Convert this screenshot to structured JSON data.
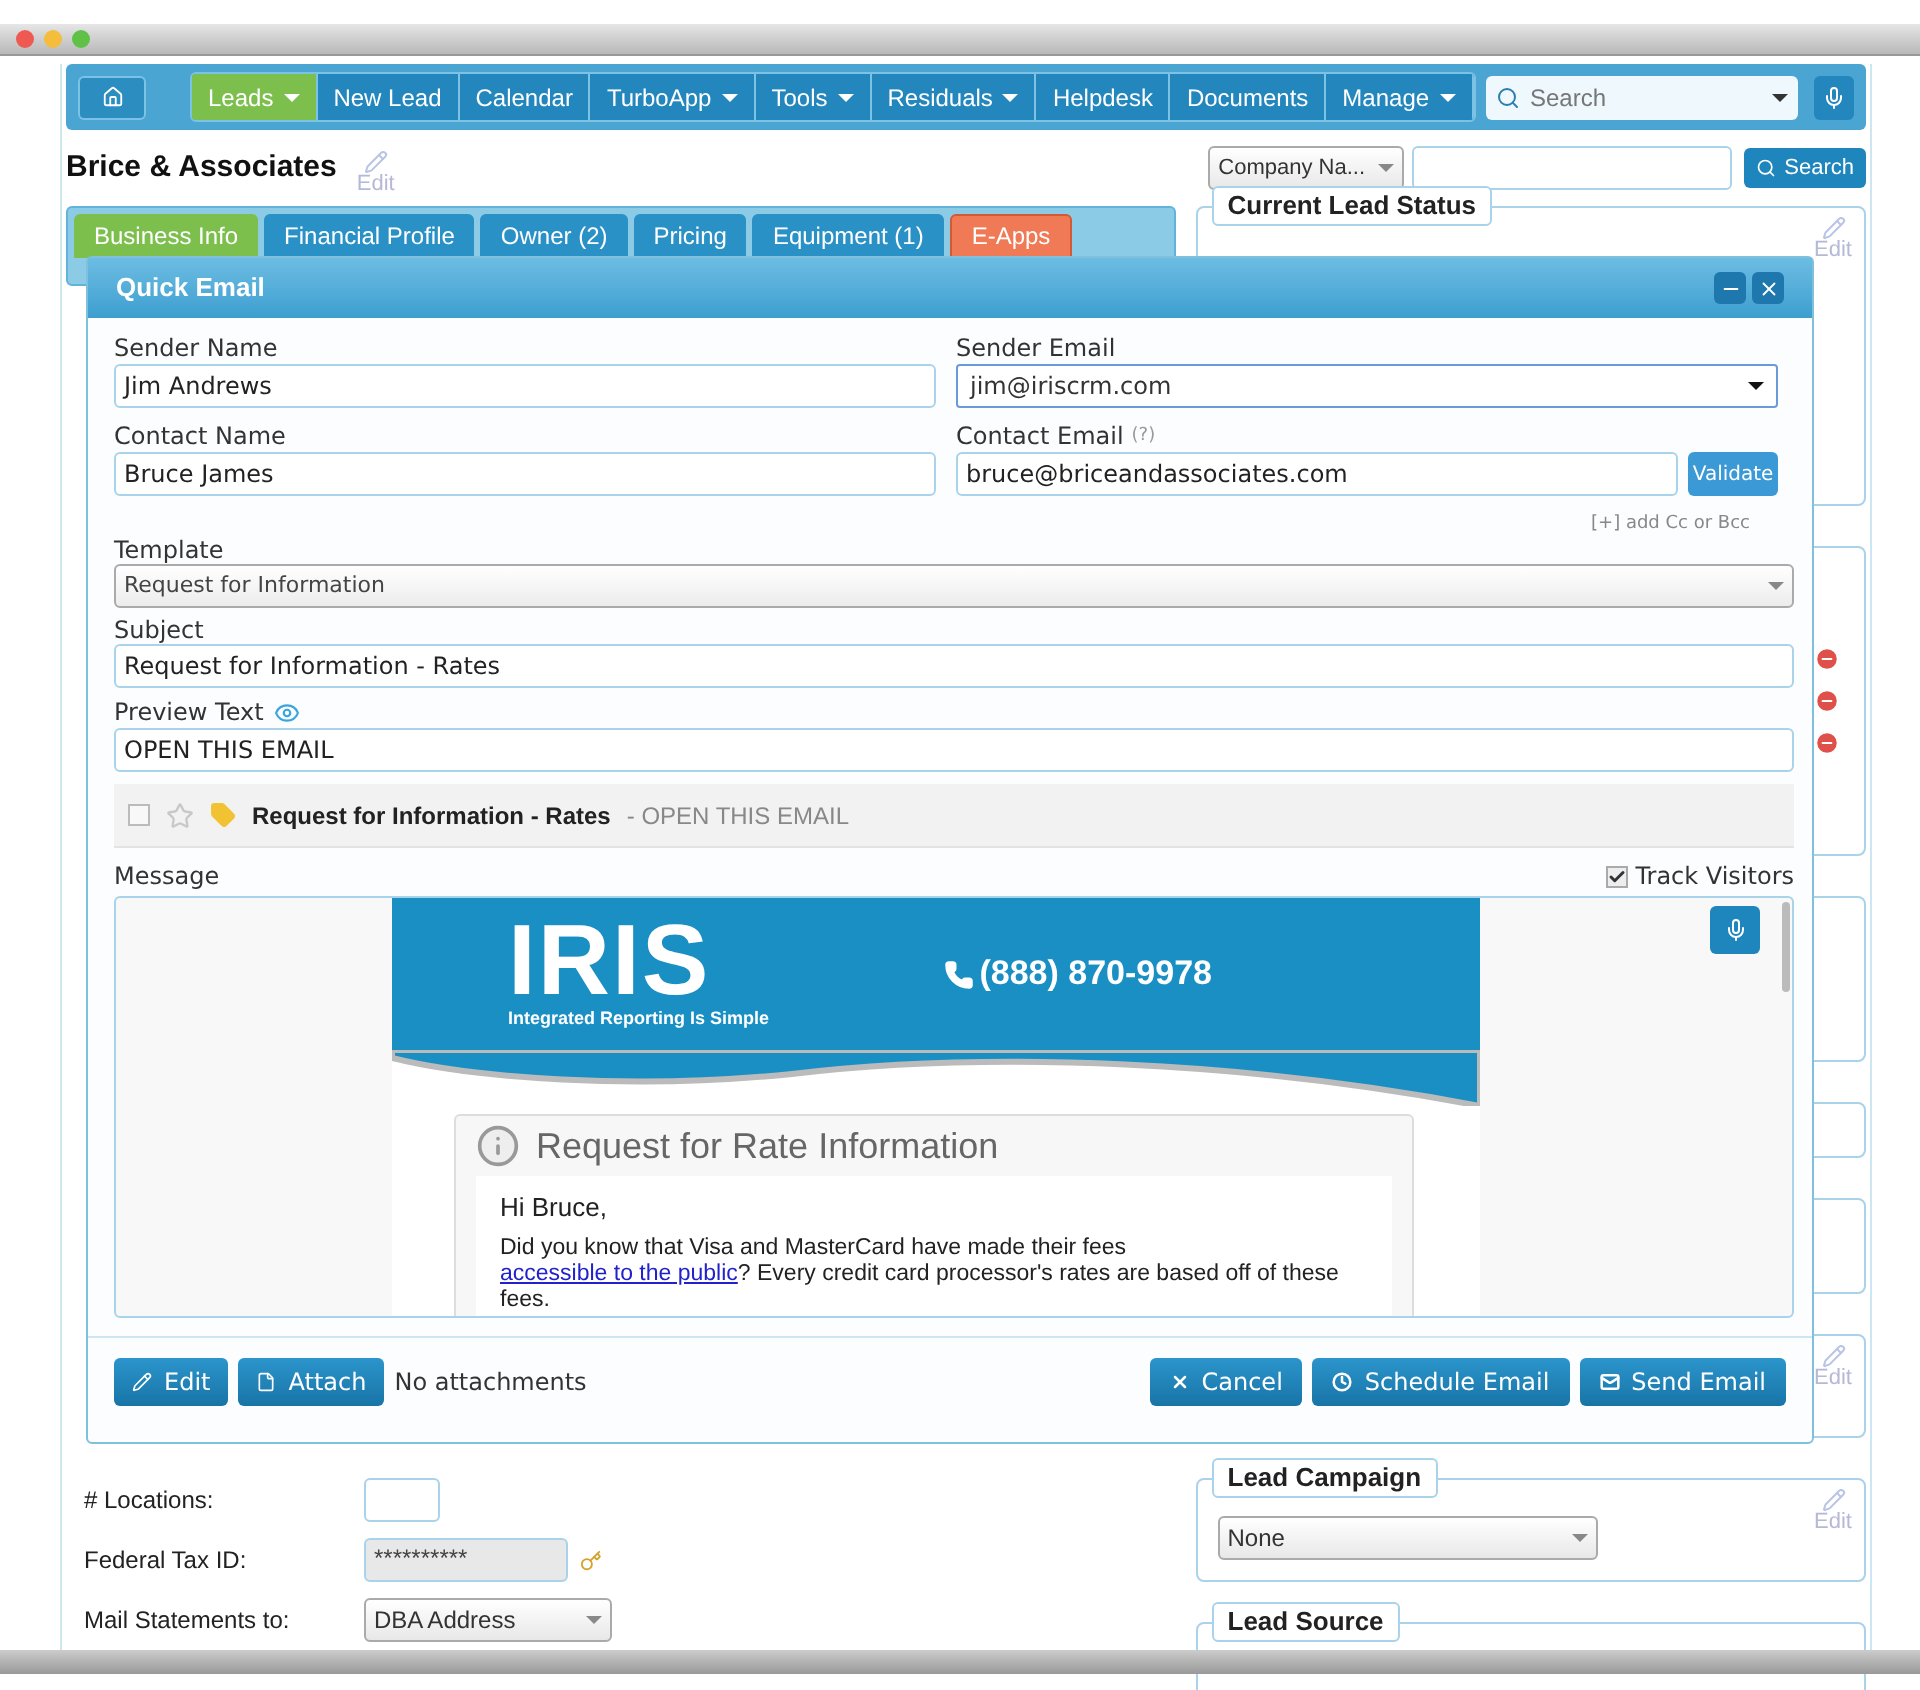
{
  "nav": {
    "items": [
      {
        "label": "Leads",
        "dropdown": true,
        "selected": true
      },
      {
        "label": "New Lead",
        "dropdown": false,
        "selected": false
      },
      {
        "label": "Calendar",
        "dropdown": false,
        "selected": false
      },
      {
        "label": "TurboApp",
        "dropdown": true,
        "selected": false
      },
      {
        "label": "Tools",
        "dropdown": true,
        "selected": false
      },
      {
        "label": "Residuals",
        "dropdown": true,
        "selected": false
      },
      {
        "label": "Helpdesk",
        "dropdown": false,
        "selected": false
      },
      {
        "label": "Documents",
        "dropdown": false,
        "selected": false
      },
      {
        "label": "Manage",
        "dropdown": true,
        "selected": false
      }
    ],
    "search": {
      "placeholder": "Search"
    }
  },
  "page": {
    "title": "Brice & Associates",
    "edit": "Edit",
    "company_select": "Company Na...",
    "search_button": "Search"
  },
  "tabs": [
    {
      "label": "Business Info",
      "selected": true,
      "kind": "standard"
    },
    {
      "label": "Financial Profile",
      "selected": false,
      "kind": "standard"
    },
    {
      "label": "Owner (2)",
      "selected": false,
      "kind": "standard"
    },
    {
      "label": "Pricing",
      "selected": false,
      "kind": "standard"
    },
    {
      "label": "Equipment (1)",
      "selected": false,
      "kind": "standard"
    },
    {
      "label": "E-Apps",
      "selected": false,
      "kind": "accent"
    }
  ],
  "fields": [
    {
      "label": "# Locations:",
      "kind": "blank"
    },
    {
      "label": "Federal Tax ID:",
      "kind": "masked",
      "value": "**********"
    },
    {
      "label": "Mail Statements to:",
      "kind": "select",
      "value": "DBA Address"
    }
  ],
  "panels": [
    {
      "title": "Current Lead Status",
      "edit": "Edit"
    },
    {
      "edit": "Edit"
    },
    {
      "title": "Lead Campaign",
      "edit": "Edit",
      "select": "None"
    },
    {
      "title": "Lead Source"
    }
  ],
  "modal": {
    "title": "Quick Email",
    "sender_name": {
      "label": "Sender Name",
      "value": "Jim Andrews"
    },
    "sender_email": {
      "label": "Sender Email",
      "value": "jim@iriscrm.com"
    },
    "contact_name": {
      "label": "Contact Name",
      "value": "Bruce James"
    },
    "contact_email": {
      "label": "Contact Email",
      "help": "(?)",
      "value": "bruce@briceandassociates.com",
      "button": "Validate"
    },
    "cc_link": "[+] add Cc or Bcc",
    "template": {
      "label": "Template",
      "value": "Request for Information"
    },
    "subject": {
      "label": "Subject",
      "value": "Request for Information - Rates"
    },
    "preview_text": {
      "label": "Preview Text",
      "value": "OPEN THIS EMAIL"
    },
    "inbox_preview": {
      "checked": false,
      "starred": false,
      "subject": "Request for Information - Rates",
      "snippet": "- OPEN THIS EMAIL"
    },
    "message": {
      "label": "Message",
      "track_visitors": {
        "label": "Track Visitors",
        "checked": true
      }
    },
    "email": {
      "logo": "IRIS",
      "tagline": "Integrated Reporting Is Simple",
      "phone": "(888) 870-9978",
      "card_title": "Request for Rate Information",
      "greeting": "Hi Bruce,",
      "body_before": "Did you know that Visa and MasterCard have made their fees ",
      "link": "accessible to the public",
      "body_after": "? Every credit card processor's rates are based off of these fees."
    },
    "left_buttons": [
      "Edit",
      "Attach"
    ],
    "attachments": "No attachments",
    "right_buttons": [
      "Cancel",
      "Schedule Email",
      "Send Email"
    ]
  }
}
